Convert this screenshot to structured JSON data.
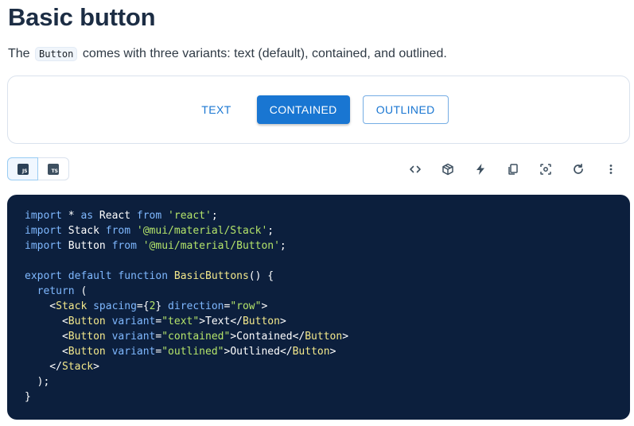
{
  "page": {
    "title": "Basic button",
    "desc_before": "The",
    "desc_code": "Button",
    "desc_after": "comes with three variants: text (default), contained, and outlined."
  },
  "demo": {
    "buttons": [
      {
        "label": "TEXT",
        "variant": "text"
      },
      {
        "label": "CONTAINED",
        "variant": "contained"
      },
      {
        "label": "OUTLINED",
        "variant": "outlined"
      }
    ],
    "accent_color": "#1976d2"
  },
  "language_toggle": {
    "options": [
      {
        "label": "JS",
        "active": true
      },
      {
        "label": "TS",
        "active": false
      }
    ]
  },
  "toolbar": {
    "icons": [
      "code-icon",
      "codesandbox-icon",
      "stackblitz-icon",
      "copy-icon",
      "focus-icon",
      "reset-icon",
      "more-vert-icon"
    ]
  },
  "code": {
    "background": "#0c1f3d",
    "lines": [
      [
        [
          "kw",
          "import"
        ],
        [
          "plain",
          " * "
        ],
        [
          "kw",
          "as"
        ],
        [
          "plain",
          " React "
        ],
        [
          "kw",
          "from"
        ],
        [
          "plain",
          " "
        ],
        [
          "str",
          "'react'"
        ],
        [
          "plain",
          ";"
        ]
      ],
      [
        [
          "kw",
          "import"
        ],
        [
          "plain",
          " Stack "
        ],
        [
          "kw",
          "from"
        ],
        [
          "plain",
          " "
        ],
        [
          "str",
          "'@mui/material/Stack'"
        ],
        [
          "plain",
          ";"
        ]
      ],
      [
        [
          "kw",
          "import"
        ],
        [
          "plain",
          " Button "
        ],
        [
          "kw",
          "from"
        ],
        [
          "plain",
          " "
        ],
        [
          "str",
          "'@mui/material/Button'"
        ],
        [
          "plain",
          ";"
        ]
      ],
      [],
      [
        [
          "kw",
          "export"
        ],
        [
          "plain",
          " "
        ],
        [
          "kw",
          "default"
        ],
        [
          "plain",
          " "
        ],
        [
          "kw",
          "function"
        ],
        [
          "plain",
          " "
        ],
        [
          "fn",
          "BasicButtons"
        ],
        [
          "plain",
          "() {"
        ]
      ],
      [
        [
          "plain",
          "  "
        ],
        [
          "kw",
          "return"
        ],
        [
          "plain",
          " ("
        ]
      ],
      [
        [
          "plain",
          "    <"
        ],
        [
          "tag",
          "Stack"
        ],
        [
          "plain",
          " "
        ],
        [
          "attr",
          "spacing"
        ],
        [
          "plain",
          "={"
        ],
        [
          "str",
          "2"
        ],
        [
          "plain",
          "} "
        ],
        [
          "attr",
          "direction"
        ],
        [
          "plain",
          "="
        ],
        [
          "str",
          "\"row\""
        ],
        [
          "plain",
          ">"
        ]
      ],
      [
        [
          "plain",
          "      <"
        ],
        [
          "tag",
          "Button"
        ],
        [
          "plain",
          " "
        ],
        [
          "attr",
          "variant"
        ],
        [
          "plain",
          "="
        ],
        [
          "str",
          "\"text\""
        ],
        [
          "plain",
          ">Text</"
        ],
        [
          "tag",
          "Button"
        ],
        [
          "plain",
          ">"
        ]
      ],
      [
        [
          "plain",
          "      <"
        ],
        [
          "tag",
          "Button"
        ],
        [
          "plain",
          " "
        ],
        [
          "attr",
          "variant"
        ],
        [
          "plain",
          "="
        ],
        [
          "str",
          "\"contained\""
        ],
        [
          "plain",
          ">Contained</"
        ],
        [
          "tag",
          "Button"
        ],
        [
          "plain",
          ">"
        ]
      ],
      [
        [
          "plain",
          "      <"
        ],
        [
          "tag",
          "Button"
        ],
        [
          "plain",
          " "
        ],
        [
          "attr",
          "variant"
        ],
        [
          "plain",
          "="
        ],
        [
          "str",
          "\"outlined\""
        ],
        [
          "plain",
          ">Outlined</"
        ],
        [
          "tag",
          "Button"
        ],
        [
          "plain",
          ">"
        ]
      ],
      [
        [
          "plain",
          "    </"
        ],
        [
          "tag",
          "Stack"
        ],
        [
          "plain",
          ">"
        ]
      ],
      [
        [
          "plain",
          "  );"
        ]
      ],
      [
        [
          "plain",
          "}"
        ]
      ]
    ]
  }
}
